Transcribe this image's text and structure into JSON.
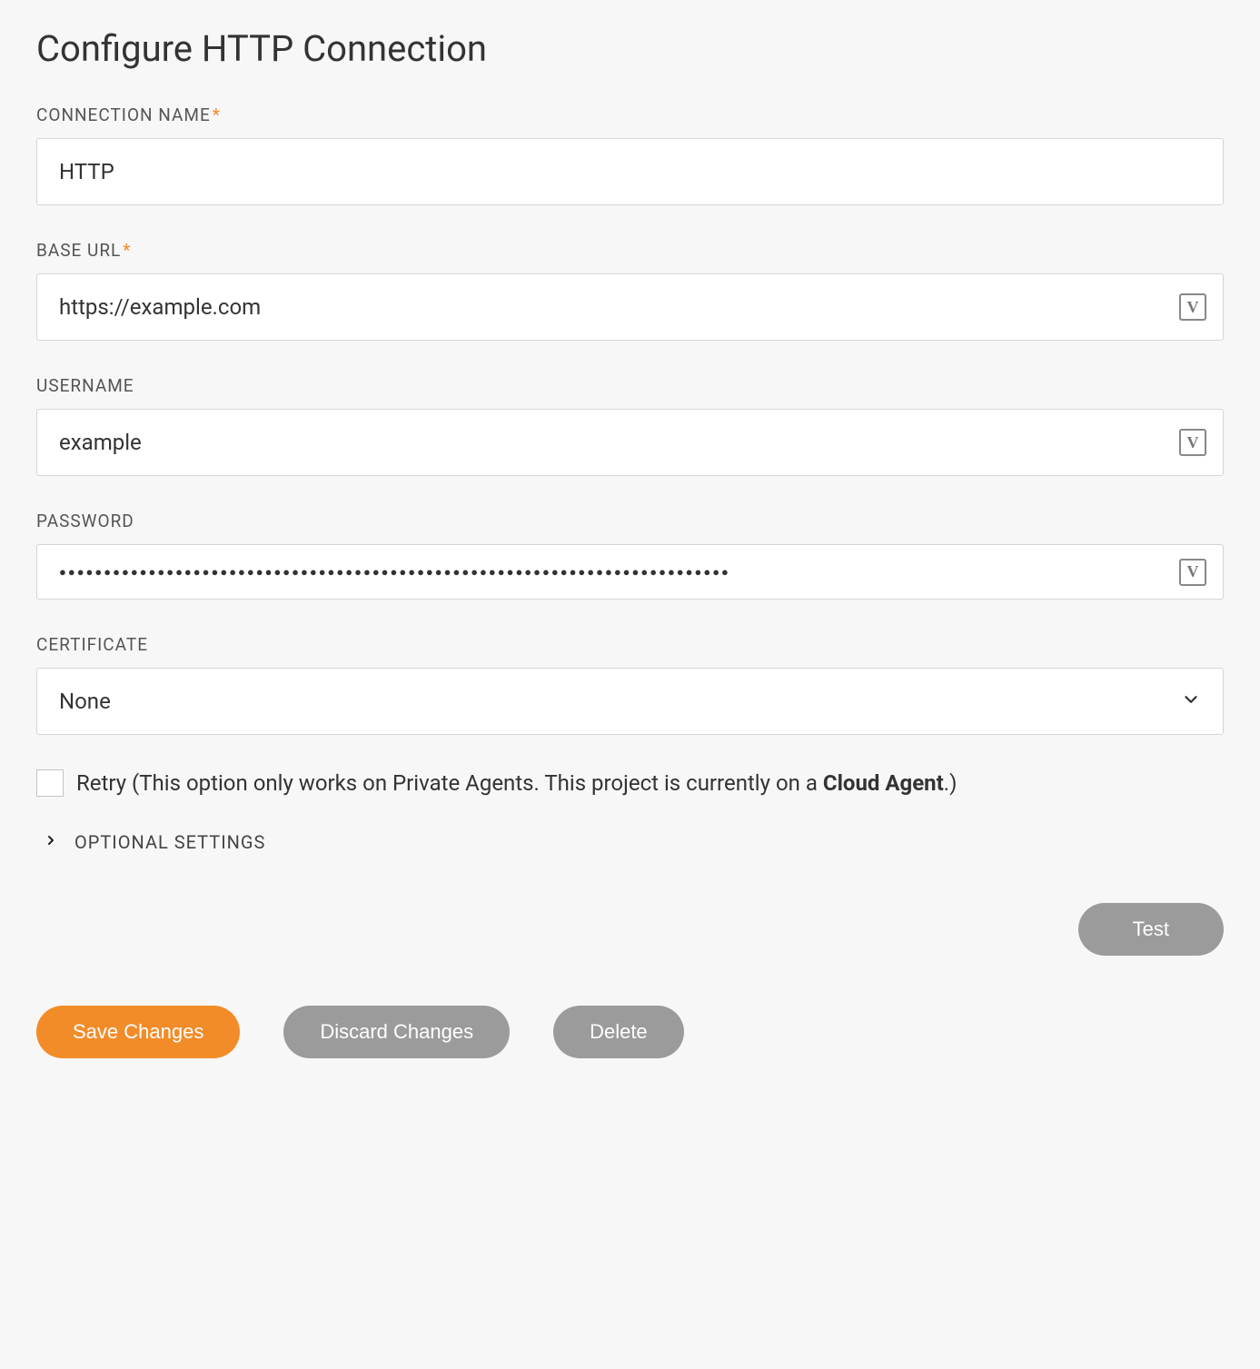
{
  "title": "Configure HTTP Connection",
  "fields": {
    "connection_name": {
      "label": "Connection Name",
      "required": true,
      "value": "HTTP",
      "has_variable_badge": false
    },
    "base_url": {
      "label": "Base URL",
      "required": true,
      "value": "https://example.com",
      "has_variable_badge": true
    },
    "username": {
      "label": "Username",
      "required": false,
      "value": "example",
      "has_variable_badge": true
    },
    "password": {
      "label": "Password",
      "required": false,
      "value": "●●●●●●●●●●●●●●●●●●●●●●●●●●●●●●●●●●●●●●●●●●●●●●●●●●●●●●●●●●●●●●●●●●●●●●●●●●●",
      "has_variable_badge": true
    },
    "certificate": {
      "label": "Certificate",
      "required": false,
      "value": "None",
      "has_variable_badge": false
    }
  },
  "retry_checkbox": {
    "checked": false,
    "label_prefix": "Retry (This option only works on Private Agents. This project is currently on a ",
    "label_bold": "Cloud Agent",
    "label_suffix": ".)"
  },
  "optional_settings_label": "Optional Settings",
  "variable_badge_text": "V",
  "buttons": {
    "test": "Test",
    "save": "Save Changes",
    "discard": "Discard Changes",
    "delete": "Delete"
  }
}
